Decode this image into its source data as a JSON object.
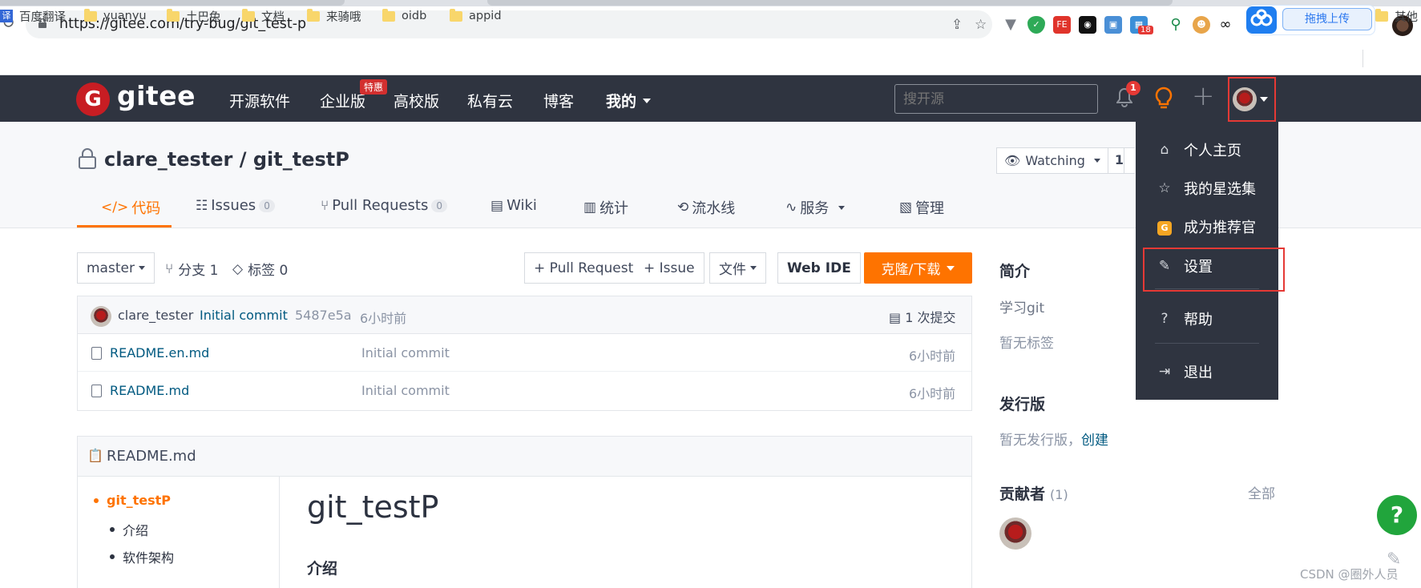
{
  "browser": {
    "url": "https://gitee.com/try-bug/git_test-p",
    "upload_label": "拖拽上传",
    "extension_badge": "18",
    "bookmarks": [
      "百度翻译",
      "yuanyu",
      "土巴兔",
      "文档",
      "来骑哦",
      "oidb",
      "appid"
    ],
    "bookmark_other": "其他",
    "translate_icon_char": "译"
  },
  "nav": {
    "logo_text": "gitee",
    "logo_letter": "G",
    "items": [
      "开源软件",
      "企业版",
      "高校版",
      "私有云",
      "博客",
      "我的"
    ],
    "hot_badge": "特惠",
    "search_placeholder": "搜开源",
    "notification_count": "1"
  },
  "repo": {
    "title": "clare_tester / git_testP",
    "watch_label": "Watching",
    "watch_count": "1",
    "tabs": [
      {
        "label": "代码",
        "icon": "code-icon"
      },
      {
        "label": "Issues",
        "count": "0",
        "icon": "issues-icon"
      },
      {
        "label": "Pull Requests",
        "count": "0",
        "icon": "pull-request-icon"
      },
      {
        "label": "Wiki",
        "icon": "wiki-icon"
      },
      {
        "label": "统计",
        "icon": "stats-icon"
      },
      {
        "label": "流水线",
        "icon": "pipeline-icon"
      },
      {
        "label": "服务",
        "icon": "service-icon"
      },
      {
        "label": "管理",
        "icon": "manage-icon"
      }
    ]
  },
  "toolbar": {
    "branch": "master",
    "branches": "分支 1",
    "tags": "标签 0",
    "pull_request": "+ Pull Request",
    "issue": "+ Issue",
    "file": "文件",
    "web_ide": "Web IDE",
    "clone": "克隆/下载"
  },
  "commit": {
    "author": "clare_tester",
    "message": "Initial commit",
    "hash": "5487e5a",
    "time": "6小时前",
    "total": "1 次提交"
  },
  "files": [
    {
      "name": "README.en.md",
      "message": "Initial commit",
      "time": "6小时前"
    },
    {
      "name": "README.md",
      "message": "Initial commit",
      "time": "6小时前"
    }
  ],
  "readme": {
    "filename": "README.md",
    "toc": [
      "git_testP",
      "介绍",
      "软件架构"
    ],
    "heading": "git_testP",
    "subheading": "介绍"
  },
  "sidebar": {
    "intro_title": "简介",
    "intro_text": "学习git",
    "no_tags": "暂无标签",
    "release_title": "发行版",
    "no_release": "暂无发行版，",
    "create_link": "创建",
    "contributors_title": "贡献者",
    "contributors_count": "(1)",
    "all_link": "全部"
  },
  "user_menu": {
    "items": [
      {
        "label": "个人主页",
        "icon": "home-icon"
      },
      {
        "label": "我的星选集",
        "icon": "star-icon"
      },
      {
        "label": "成为推荐官",
        "icon": "recommend-badge-icon"
      },
      {
        "label": "设置",
        "icon": "edit-settings-icon"
      },
      {
        "label": "帮助",
        "icon": "help-icon"
      },
      {
        "label": "退出",
        "icon": "logout-icon"
      }
    ]
  },
  "watermark": "CSDN @圈外人员",
  "colors": {
    "nav_bg": "#2f3440",
    "accent": "#fe7300",
    "link": "#005980",
    "highlight": "#e53935"
  }
}
